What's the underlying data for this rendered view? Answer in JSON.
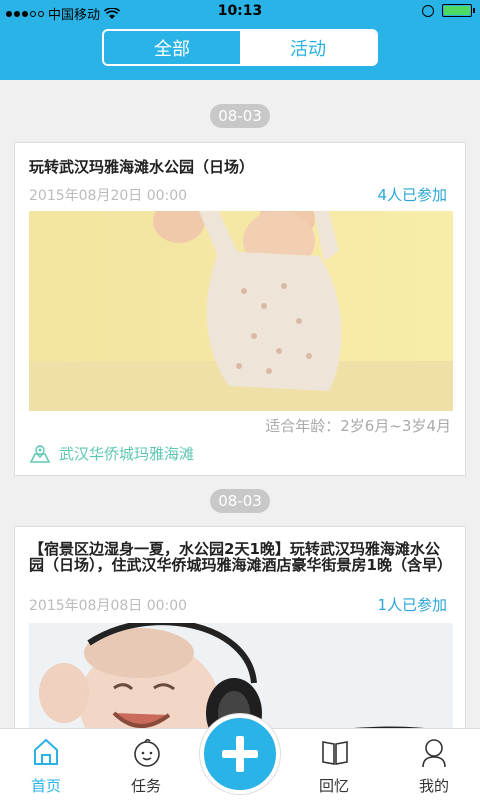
{
  "status_bar": {
    "carrier": "中国移动",
    "time": "10:13"
  },
  "tabs": [
    {
      "label": "全部",
      "active": true
    },
    {
      "label": "活动",
      "active": false
    }
  ],
  "feed": [
    {
      "date": "08-03",
      "title": "玩转武汉玛雅海滩水公园（日场）",
      "event_time": "2015年08月20日 00:00",
      "joined": "4人已参加",
      "age_range": "适合年龄：2岁6月~3岁4月",
      "location": "武汉华侨城玛雅海滩",
      "image_icon": "baby-dancing-photo"
    },
    {
      "date": "08-03",
      "title": "【宿景区边湿身一夏，水公园2天1晚】玩转武汉玛雅海滩水公园（日场），住武汉华侨城玛雅海滩酒店豪华街景房1晚（含早）",
      "event_time": "2015年08月08日 00:00",
      "joined": "1人已参加",
      "image_icon": "baby-headphones-photo"
    }
  ],
  "bottom_nav": [
    {
      "label": "首页",
      "icon": "home-icon",
      "active": true
    },
    {
      "label": "任务",
      "icon": "baby-face-icon",
      "active": false
    },
    {
      "label": "",
      "icon": "plus-icon",
      "active": false
    },
    {
      "label": "回忆",
      "icon": "book-icon",
      "active": false
    },
    {
      "label": "我的",
      "icon": "person-icon",
      "active": false
    }
  ],
  "colors": {
    "accent": "#2ab3e6",
    "location": "#5ec7b3",
    "count": "#2aa6d8"
  }
}
